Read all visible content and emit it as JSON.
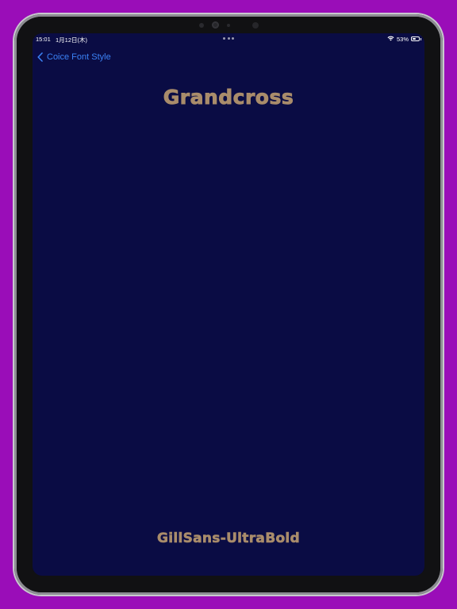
{
  "status_bar": {
    "time": "15:01",
    "date": "1月12日(木)",
    "battery_percent": "53%",
    "battery_level": 0.53
  },
  "nav": {
    "back_label": "Coice Font Style"
  },
  "content": {
    "sample_text": "Grandcross",
    "font_name": "GillSans-UltraBold"
  },
  "colors": {
    "background_outer": "#9a0db8",
    "screen_background": "#0a0c44",
    "accent_link": "#3b82f6",
    "text_tan": "#a98c6b"
  },
  "icons": {
    "back": "chevron-left-icon",
    "wifi": "wifi-icon",
    "battery": "battery-icon",
    "multitask": "more-dots-icon"
  }
}
